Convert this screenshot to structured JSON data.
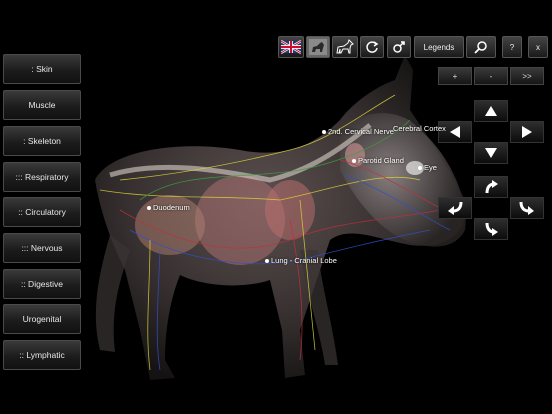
{
  "sidebar": {
    "items": [
      {
        "label": ": Skin"
      },
      {
        "label": "Muscle"
      },
      {
        "label": ": Skeleton"
      },
      {
        "label": "::: Respiratory"
      },
      {
        "label": ":: Circulatory"
      },
      {
        "label": "::: Nervous"
      },
      {
        "label": ":: Digestive"
      },
      {
        "label": "Urogenital"
      },
      {
        "label": ":: Lymphatic"
      }
    ]
  },
  "toolbar": {
    "legends_label": "Legends",
    "help_label": "?",
    "close_label": "x"
  },
  "zoom": {
    "plus_label": "+",
    "minus_label": "-",
    "next_label": ">>"
  },
  "anatomy_labels": [
    {
      "text": "2nd. Cervical Nerve"
    },
    {
      "text": "Cerebral Cortex"
    },
    {
      "text": "Parotid Gland"
    },
    {
      "text": "Eye"
    },
    {
      "text": "Duodenum"
    },
    {
      "text": "Lung - Cranial Lobe"
    }
  ],
  "colors": {
    "background": "#000000",
    "nerve_yellow": "#d8d23a",
    "artery_red": "#c0303a",
    "vein_blue": "#3050c8",
    "lymph_green": "#3aa040"
  },
  "icons": [
    "uk-flag-icon",
    "dog-photo-icon",
    "dog-silhouette-icon",
    "reset-rotate-icon",
    "male-symbol-icon",
    "search-icon"
  ]
}
